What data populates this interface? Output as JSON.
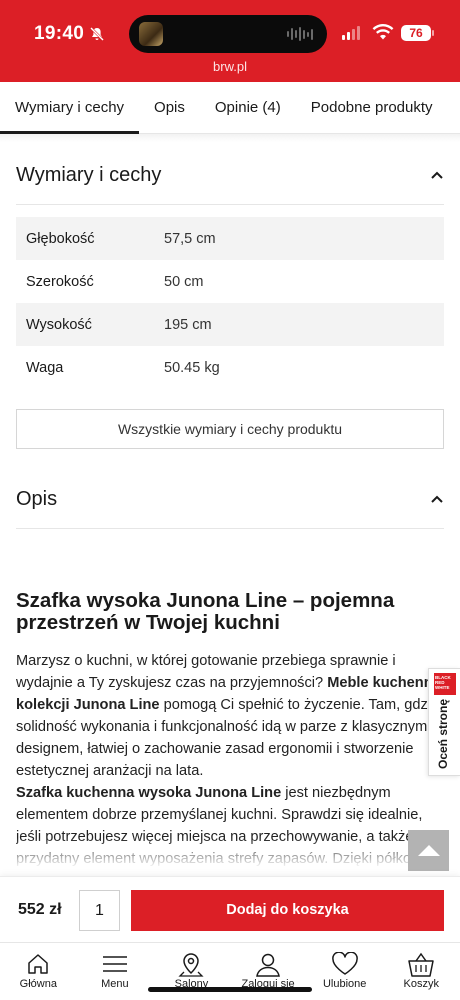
{
  "status_bar": {
    "time": "19:40",
    "battery": "76",
    "url": "brw.pl"
  },
  "tabs": [
    {
      "label": "Wymiary i cechy",
      "active": true
    },
    {
      "label": "Opis",
      "active": false
    },
    {
      "label": "Opinie (4)",
      "active": false
    },
    {
      "label": "Podobne produkty",
      "active": false
    }
  ],
  "dimensions": {
    "title": "Wymiary i cechy",
    "rows": [
      {
        "name": "Głębokość",
        "value": "57,5 cm"
      },
      {
        "name": "Szerokość",
        "value": "50 cm"
      },
      {
        "name": "Wysokość",
        "value": "195 cm"
      },
      {
        "name": "Waga",
        "value": "50.45 kg"
      }
    ],
    "all_button": "Wszystkie wymiary i cechy produktu"
  },
  "description": {
    "title": "Opis",
    "heading": "Szafka wysoka Junona Line  – pojemna przestrzeń w Twojej kuchni",
    "p1_a": "Marzysz o kuchni, w której gotowanie przebiega sprawnie i wydajnie a Ty zyskujesz czas na przyjemności? ",
    "p1_b": "Meble kuchenne kolekcji Junona Line",
    "p1_c": " pomogą Ci spełnić to życzenie. Tam, gdzie solidność wykonania i funkcjonalność idą w parze z klasycznym designem, łatwiej o zachowanie zasad ergonomii i stworzenie estetycznej aranżacji na lata.",
    "p2_a": "Szafka kuchenna wysoka Junona Line",
    "p2_b": " jest niezbędnym elementem dobrze przemyślanej kuchni. Sprawdzi się idealnie, jeśli potrzebujesz więcej miejsca na przechowywanie, a także przydatny element wyposażenia strefy zapasów. Dzięki półkom"
  },
  "rate_widget": {
    "logo": "BLACK RED WHITE",
    "label": "Oceń stronę"
  },
  "cart": {
    "price": "552 zł",
    "quantity": "1",
    "add_label": "Dodaj do koszyka"
  },
  "bottom_nav": [
    {
      "label": "Główna",
      "icon": "home-icon"
    },
    {
      "label": "Menu",
      "icon": "menu-icon"
    },
    {
      "label": "Salony",
      "icon": "location-pin-icon"
    },
    {
      "label": "Zaloguj się",
      "icon": "user-icon"
    },
    {
      "label": "Ulubione",
      "icon": "heart-icon"
    },
    {
      "label": "Koszyk",
      "icon": "basket-icon"
    }
  ],
  "colors": {
    "brand_red": "#dc1f26",
    "row_shade": "#f3f3f3"
  }
}
